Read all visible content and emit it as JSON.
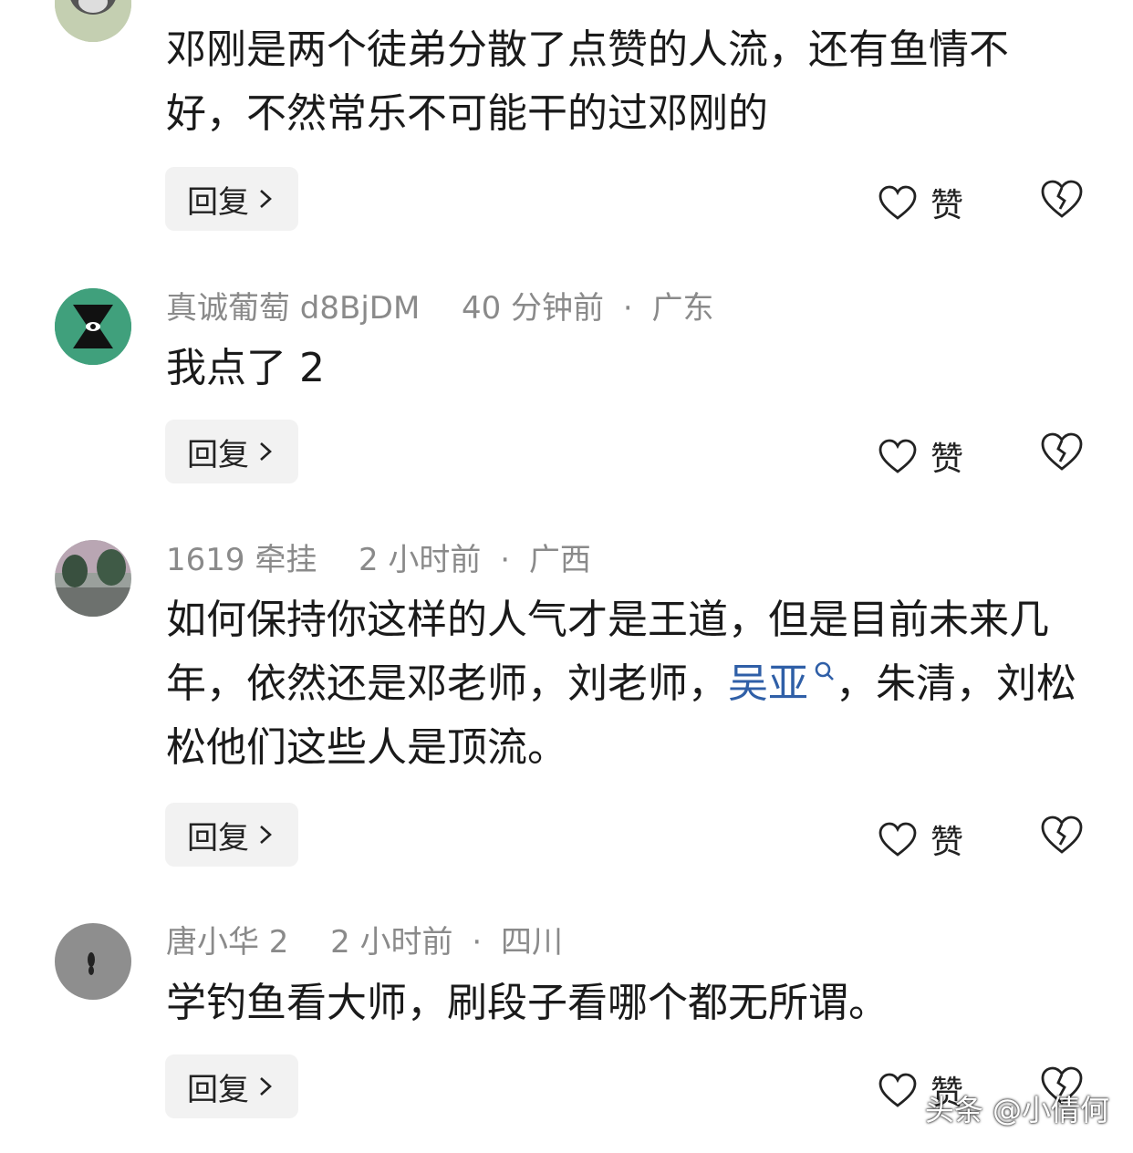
{
  "comments": [
    {
      "meta": {
        "user": "",
        "time": "",
        "region": ""
      },
      "text": "邓刚是两个徒弟分散了点赞的人流，还有鱼情不好，不然常乐不可能干的过邓刚的",
      "reply_label": "回复",
      "like_label": "赞"
    },
    {
      "meta": {
        "user": "真诚葡萄 d8BjDM",
        "time": "40 分钟前",
        "region": "广东"
      },
      "text": "我点了 2",
      "reply_label": "回复",
      "like_label": "赞"
    },
    {
      "meta": {
        "user": "1619 牵挂",
        "time": "2 小时前",
        "region": "广西"
      },
      "text_before": "如何保持你这样的人气才是王道，但是目前未来几年，依然还是邓老师，刘老师，",
      "link": "吴亚",
      "text_after": "，朱清，刘松松他们这些人是顶流。",
      "reply_label": "回复",
      "like_label": "赞"
    },
    {
      "meta": {
        "user": "唐小华 2",
        "time": "2 小时前",
        "region": "四川"
      },
      "text": "学钓鱼看大师，刷段子看哪个都无所谓。",
      "reply_label": "回复",
      "like_label": "赞"
    }
  ],
  "meta_separator": "·",
  "watermark": "头条 @小倩何",
  "colors": {
    "meta_gray": "#8a8a8a",
    "link_blue": "#2f5fa7",
    "reply_bg": "#f2f2f2"
  },
  "icons": {
    "reply_arrow": "chevron-right-icon",
    "like": "heart-outline-icon",
    "dislike": "broken-heart-icon",
    "search": "search-icon"
  }
}
